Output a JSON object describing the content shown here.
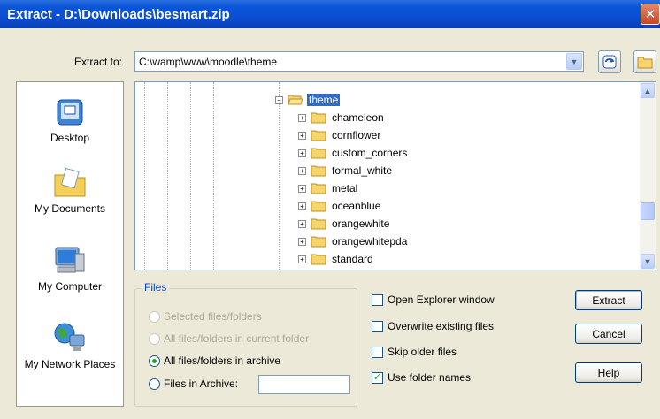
{
  "window": {
    "title": "Extract - D:\\Downloads\\besmart.zip",
    "close_glyph": "✕"
  },
  "extract_to": {
    "label": "Extract to:",
    "value": "C:\\wamp\\www\\moodle\\theme"
  },
  "places": [
    {
      "label": "Desktop",
      "icon": "desktop-icon"
    },
    {
      "label": "My Documents",
      "icon": "my-documents-icon"
    },
    {
      "label": "My Computer",
      "icon": "my-computer-icon"
    },
    {
      "label": "My Network Places",
      "icon": "network-places-icon"
    }
  ],
  "tree": {
    "selected": "theme",
    "children": [
      "chameleon",
      "cornflower",
      "custom_corners",
      "formal_white",
      "metal",
      "oceanblue",
      "orangewhite",
      "orangewhitepda",
      "standard"
    ]
  },
  "files": {
    "legend": "Files",
    "options": [
      {
        "label": "Selected files/folders",
        "enabled": false,
        "checked": false
      },
      {
        "label": "All files/folders in current folder",
        "enabled": false,
        "checked": false
      },
      {
        "label": "All files/folders in archive",
        "enabled": true,
        "checked": true
      },
      {
        "label": "Files in Archive:",
        "enabled": true,
        "checked": false
      }
    ],
    "files_in_archive_value": ""
  },
  "checkboxes": [
    {
      "label": "Open Explorer window",
      "checked": false
    },
    {
      "label": "Overwrite existing files",
      "checked": false
    },
    {
      "label": "Skip older files",
      "checked": false
    },
    {
      "label": "Use folder names",
      "checked": true
    }
  ],
  "buttons": {
    "extract": "Extract",
    "cancel": "Cancel",
    "help": "Help"
  },
  "colors": {
    "titlebar": "#0a55d8",
    "selection": "#316ac5",
    "dialog_bg": "#ece9d8"
  }
}
